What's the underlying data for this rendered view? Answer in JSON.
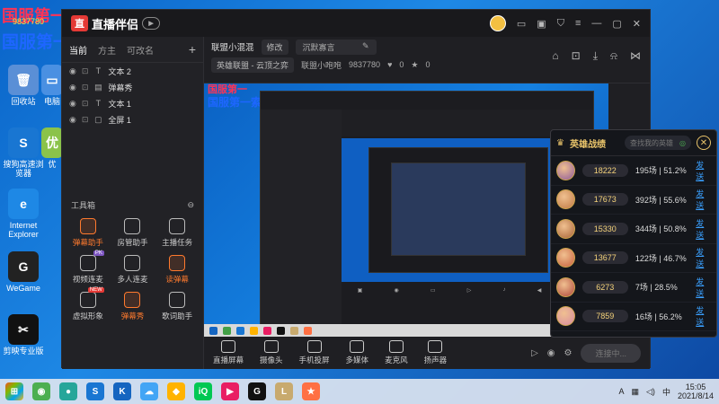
{
  "watermark": {
    "top_text": "国服第一",
    "main_text": "国服第一索拉卡",
    "sub": "9837780"
  },
  "desktop_icons": [
    {
      "label": "回收站",
      "color": "#5a8fd6",
      "glyph": "🗑"
    },
    {
      "label": "搜狗高速浏览器",
      "color": "#1976d2",
      "glyph": "S"
    },
    {
      "label": "Internet Explorer",
      "color": "#1e88e5",
      "glyph": "e"
    },
    {
      "label": "WeGame",
      "color": "#222",
      "glyph": "G"
    },
    {
      "label": "剪映专业版",
      "color": "#111",
      "glyph": "✂"
    }
  ],
  "desktop_icons_col2": [
    {
      "label": "电脑",
      "color": "#4a90e2",
      "glyph": "▭"
    },
    {
      "label": "优",
      "color": "#8bc34a",
      "glyph": "优"
    }
  ],
  "app": {
    "brand": "直播伴侣",
    "left_tabs": [
      "当前",
      "方主",
      "可改名"
    ],
    "layers": [
      {
        "kind": "T",
        "name": "文本 2"
      },
      {
        "kind": "▤",
        "name": "弹幕秀"
      },
      {
        "kind": "T",
        "name": "文本 1"
      },
      {
        "kind": "▢",
        "name": "全屏 1"
      }
    ],
    "tools_label": "工具箱",
    "tools": [
      {
        "label": "弹幕助手",
        "orange": true,
        "tag": ""
      },
      {
        "label": "房管助手",
        "orange": false,
        "tag": ""
      },
      {
        "label": "主播任务",
        "orange": false,
        "tag": ""
      },
      {
        "label": "视频连麦",
        "orange": false,
        "tag": "PK"
      },
      {
        "label": "多人连麦",
        "orange": false,
        "tag": ""
      },
      {
        "label": "读弹幕",
        "orange": true,
        "tag": ""
      },
      {
        "label": "虚拟形象",
        "orange": false,
        "tag": "NEW"
      },
      {
        "label": "弹幕秀",
        "orange": true,
        "tag": ""
      },
      {
        "label": "歌词助手",
        "orange": false,
        "tag": ""
      }
    ],
    "room": {
      "name": "联盟小混混",
      "edit_btn": "修改",
      "notice_placeholder": "沉默寡言",
      "category": "英雄联盟 - 云顶之弈",
      "anchor": "联盟小咆咆",
      "room_id": "9837780",
      "likes": "0",
      "fans": "0"
    },
    "bottom_tools": [
      "直播屏幕",
      "摄像头",
      "手机投屏",
      "多媒体",
      "麦克风",
      "扬声器"
    ],
    "start_label": "连接中..."
  },
  "hero_panel": {
    "title": "英雄战绩",
    "search_placeholder": "查找我的英雄",
    "send_label": "发送",
    "rows": [
      {
        "score": "18222",
        "record": "195场 | 51.2%"
      },
      {
        "score": "17673",
        "record": "392场 | 55.6%"
      },
      {
        "score": "15330",
        "record": "344场 | 50.8%"
      },
      {
        "score": "13677",
        "record": "122场 | 46.7%"
      },
      {
        "score": "6273",
        "record": "7场 | 28.5%"
      },
      {
        "score": "7859",
        "record": "16场 | 56.2%"
      }
    ]
  },
  "taskbar": {
    "time": "15:05",
    "date": "2021/8/14",
    "apps": [
      {
        "glyph": "◉",
        "color": "#4caf50"
      },
      {
        "glyph": "●",
        "color": "#26a69a"
      },
      {
        "glyph": "S",
        "color": "#1976d2"
      },
      {
        "glyph": "K",
        "color": "#1565c0"
      },
      {
        "glyph": "☁",
        "color": "#42a5f5"
      },
      {
        "glyph": "◆",
        "color": "#ffb300"
      },
      {
        "glyph": "iQ",
        "color": "#00c853"
      },
      {
        "glyph": "▶",
        "color": "#e91e63"
      },
      {
        "glyph": "G",
        "color": "#111"
      },
      {
        "glyph": "L",
        "color": "#c8aa6e"
      },
      {
        "glyph": "★",
        "color": "#ff7043"
      }
    ]
  },
  "colors": {
    "accent": "#ff7a2e",
    "gold": "#e8c36a",
    "link": "#3aa0ff"
  }
}
